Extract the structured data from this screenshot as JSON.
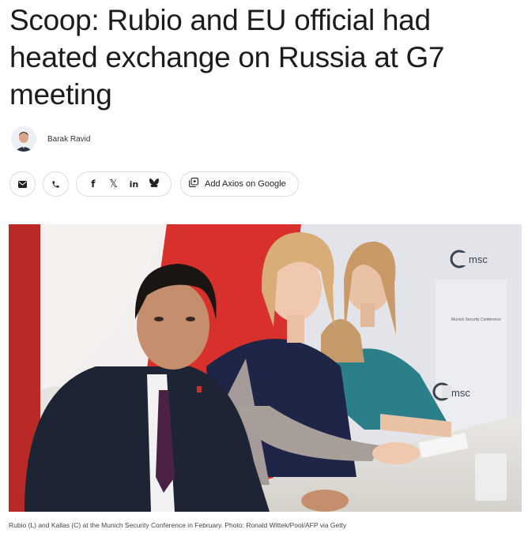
{
  "article": {
    "headline": "Scoop: Rubio and EU official had heated exchange on Russia at G7 meeting",
    "author": "Barak Ravid"
  },
  "share": {
    "email_icon": "envelope-icon",
    "phone_icon": "phone-icon",
    "facebook_glyph": "f",
    "x_glyph": "𝕏",
    "linkedin_glyph": "in",
    "bluesky_icon": "butterfly-icon",
    "google_label": "Add Axios on Google"
  },
  "photo": {
    "logo_text_top": "msc",
    "logo_text_bottom": "msc",
    "backdrop_text": "Munich Security Conference"
  },
  "caption": "Rubio (L) and Kallas (C) at the Munich Security Conference in February. Photo: Ronald Wittek/Pool/AFP via Getty",
  "colors": {
    "flag_red": "#d8302c",
    "backdrop": "#e4e5ea",
    "suit": "#1d2433"
  }
}
